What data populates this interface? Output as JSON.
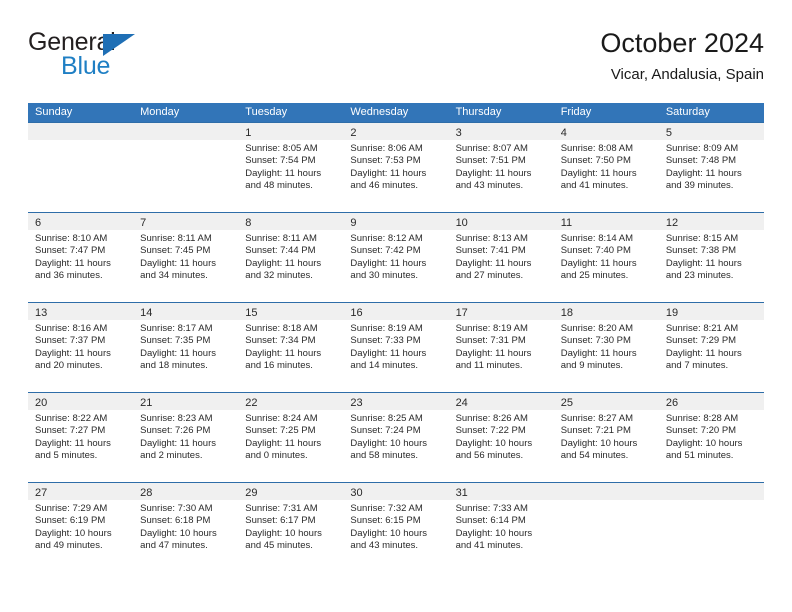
{
  "brand": {
    "name_top": "General",
    "name_bottom": "Blue",
    "triangle_icon": "blue-triangle-logo-mark",
    "color_dark": "#231f20",
    "color_blue": "#1f7fc4"
  },
  "header": {
    "title": "October 2024",
    "subtitle": "Vicar, Andalusia, Spain"
  },
  "theme": {
    "header_blue": "#3275b8",
    "row_divider_blue": "#2e6da8",
    "date_band_gray": "#f0f0f0",
    "text": "#2a2a2a"
  },
  "weekdays": [
    "Sunday",
    "Monday",
    "Tuesday",
    "Wednesday",
    "Thursday",
    "Friday",
    "Saturday"
  ],
  "weeks": [
    [
      {
        "day": "",
        "sunrise": "",
        "sunset": "",
        "daylight_line1": "",
        "daylight_line2": "",
        "empty": true
      },
      {
        "day": "",
        "sunrise": "",
        "sunset": "",
        "daylight_line1": "",
        "daylight_line2": "",
        "empty": true
      },
      {
        "day": "1",
        "sunrise": "Sunrise: 8:05 AM",
        "sunset": "Sunset: 7:54 PM",
        "daylight_line1": "Daylight: 11 hours",
        "daylight_line2": "and 48 minutes."
      },
      {
        "day": "2",
        "sunrise": "Sunrise: 8:06 AM",
        "sunset": "Sunset: 7:53 PM",
        "daylight_line1": "Daylight: 11 hours",
        "daylight_line2": "and 46 minutes."
      },
      {
        "day": "3",
        "sunrise": "Sunrise: 8:07 AM",
        "sunset": "Sunset: 7:51 PM",
        "daylight_line1": "Daylight: 11 hours",
        "daylight_line2": "and 43 minutes."
      },
      {
        "day": "4",
        "sunrise": "Sunrise: 8:08 AM",
        "sunset": "Sunset: 7:50 PM",
        "daylight_line1": "Daylight: 11 hours",
        "daylight_line2": "and 41 minutes."
      },
      {
        "day": "5",
        "sunrise": "Sunrise: 8:09 AM",
        "sunset": "Sunset: 7:48 PM",
        "daylight_line1": "Daylight: 11 hours",
        "daylight_line2": "and 39 minutes."
      }
    ],
    [
      {
        "day": "6",
        "sunrise": "Sunrise: 8:10 AM",
        "sunset": "Sunset: 7:47 PM",
        "daylight_line1": "Daylight: 11 hours",
        "daylight_line2": "and 36 minutes."
      },
      {
        "day": "7",
        "sunrise": "Sunrise: 8:11 AM",
        "sunset": "Sunset: 7:45 PM",
        "daylight_line1": "Daylight: 11 hours",
        "daylight_line2": "and 34 minutes."
      },
      {
        "day": "8",
        "sunrise": "Sunrise: 8:11 AM",
        "sunset": "Sunset: 7:44 PM",
        "daylight_line1": "Daylight: 11 hours",
        "daylight_line2": "and 32 minutes."
      },
      {
        "day": "9",
        "sunrise": "Sunrise: 8:12 AM",
        "sunset": "Sunset: 7:42 PM",
        "daylight_line1": "Daylight: 11 hours",
        "daylight_line2": "and 30 minutes."
      },
      {
        "day": "10",
        "sunrise": "Sunrise: 8:13 AM",
        "sunset": "Sunset: 7:41 PM",
        "daylight_line1": "Daylight: 11 hours",
        "daylight_line2": "and 27 minutes."
      },
      {
        "day": "11",
        "sunrise": "Sunrise: 8:14 AM",
        "sunset": "Sunset: 7:40 PM",
        "daylight_line1": "Daylight: 11 hours",
        "daylight_line2": "and 25 minutes."
      },
      {
        "day": "12",
        "sunrise": "Sunrise: 8:15 AM",
        "sunset": "Sunset: 7:38 PM",
        "daylight_line1": "Daylight: 11 hours",
        "daylight_line2": "and 23 minutes."
      }
    ],
    [
      {
        "day": "13",
        "sunrise": "Sunrise: 8:16 AM",
        "sunset": "Sunset: 7:37 PM",
        "daylight_line1": "Daylight: 11 hours",
        "daylight_line2": "and 20 minutes."
      },
      {
        "day": "14",
        "sunrise": "Sunrise: 8:17 AM",
        "sunset": "Sunset: 7:35 PM",
        "daylight_line1": "Daylight: 11 hours",
        "daylight_line2": "and 18 minutes."
      },
      {
        "day": "15",
        "sunrise": "Sunrise: 8:18 AM",
        "sunset": "Sunset: 7:34 PM",
        "daylight_line1": "Daylight: 11 hours",
        "daylight_line2": "and 16 minutes."
      },
      {
        "day": "16",
        "sunrise": "Sunrise: 8:19 AM",
        "sunset": "Sunset: 7:33 PM",
        "daylight_line1": "Daylight: 11 hours",
        "daylight_line2": "and 14 minutes."
      },
      {
        "day": "17",
        "sunrise": "Sunrise: 8:19 AM",
        "sunset": "Sunset: 7:31 PM",
        "daylight_line1": "Daylight: 11 hours",
        "daylight_line2": "and 11 minutes."
      },
      {
        "day": "18",
        "sunrise": "Sunrise: 8:20 AM",
        "sunset": "Sunset: 7:30 PM",
        "daylight_line1": "Daylight: 11 hours",
        "daylight_line2": "and 9 minutes."
      },
      {
        "day": "19",
        "sunrise": "Sunrise: 8:21 AM",
        "sunset": "Sunset: 7:29 PM",
        "daylight_line1": "Daylight: 11 hours",
        "daylight_line2": "and 7 minutes."
      }
    ],
    [
      {
        "day": "20",
        "sunrise": "Sunrise: 8:22 AM",
        "sunset": "Sunset: 7:27 PM",
        "daylight_line1": "Daylight: 11 hours",
        "daylight_line2": "and 5 minutes."
      },
      {
        "day": "21",
        "sunrise": "Sunrise: 8:23 AM",
        "sunset": "Sunset: 7:26 PM",
        "daylight_line1": "Daylight: 11 hours",
        "daylight_line2": "and 2 minutes."
      },
      {
        "day": "22",
        "sunrise": "Sunrise: 8:24 AM",
        "sunset": "Sunset: 7:25 PM",
        "daylight_line1": "Daylight: 11 hours",
        "daylight_line2": "and 0 minutes."
      },
      {
        "day": "23",
        "sunrise": "Sunrise: 8:25 AM",
        "sunset": "Sunset: 7:24 PM",
        "daylight_line1": "Daylight: 10 hours",
        "daylight_line2": "and 58 minutes."
      },
      {
        "day": "24",
        "sunrise": "Sunrise: 8:26 AM",
        "sunset": "Sunset: 7:22 PM",
        "daylight_line1": "Daylight: 10 hours",
        "daylight_line2": "and 56 minutes."
      },
      {
        "day": "25",
        "sunrise": "Sunrise: 8:27 AM",
        "sunset": "Sunset: 7:21 PM",
        "daylight_line1": "Daylight: 10 hours",
        "daylight_line2": "and 54 minutes."
      },
      {
        "day": "26",
        "sunrise": "Sunrise: 8:28 AM",
        "sunset": "Sunset: 7:20 PM",
        "daylight_line1": "Daylight: 10 hours",
        "daylight_line2": "and 51 minutes."
      }
    ],
    [
      {
        "day": "27",
        "sunrise": "Sunrise: 7:29 AM",
        "sunset": "Sunset: 6:19 PM",
        "daylight_line1": "Daylight: 10 hours",
        "daylight_line2": "and 49 minutes."
      },
      {
        "day": "28",
        "sunrise": "Sunrise: 7:30 AM",
        "sunset": "Sunset: 6:18 PM",
        "daylight_line1": "Daylight: 10 hours",
        "daylight_line2": "and 47 minutes."
      },
      {
        "day": "29",
        "sunrise": "Sunrise: 7:31 AM",
        "sunset": "Sunset: 6:17 PM",
        "daylight_line1": "Daylight: 10 hours",
        "daylight_line2": "and 45 minutes."
      },
      {
        "day": "30",
        "sunrise": "Sunrise: 7:32 AM",
        "sunset": "Sunset: 6:15 PM",
        "daylight_line1": "Daylight: 10 hours",
        "daylight_line2": "and 43 minutes."
      },
      {
        "day": "31",
        "sunrise": "Sunrise: 7:33 AM",
        "sunset": "Sunset: 6:14 PM",
        "daylight_line1": "Daylight: 10 hours",
        "daylight_line2": "and 41 minutes."
      },
      {
        "day": "",
        "sunrise": "",
        "sunset": "",
        "daylight_line1": "",
        "daylight_line2": "",
        "empty": true
      },
      {
        "day": "",
        "sunrise": "",
        "sunset": "",
        "daylight_line1": "",
        "daylight_line2": "",
        "empty": true
      }
    ]
  ]
}
